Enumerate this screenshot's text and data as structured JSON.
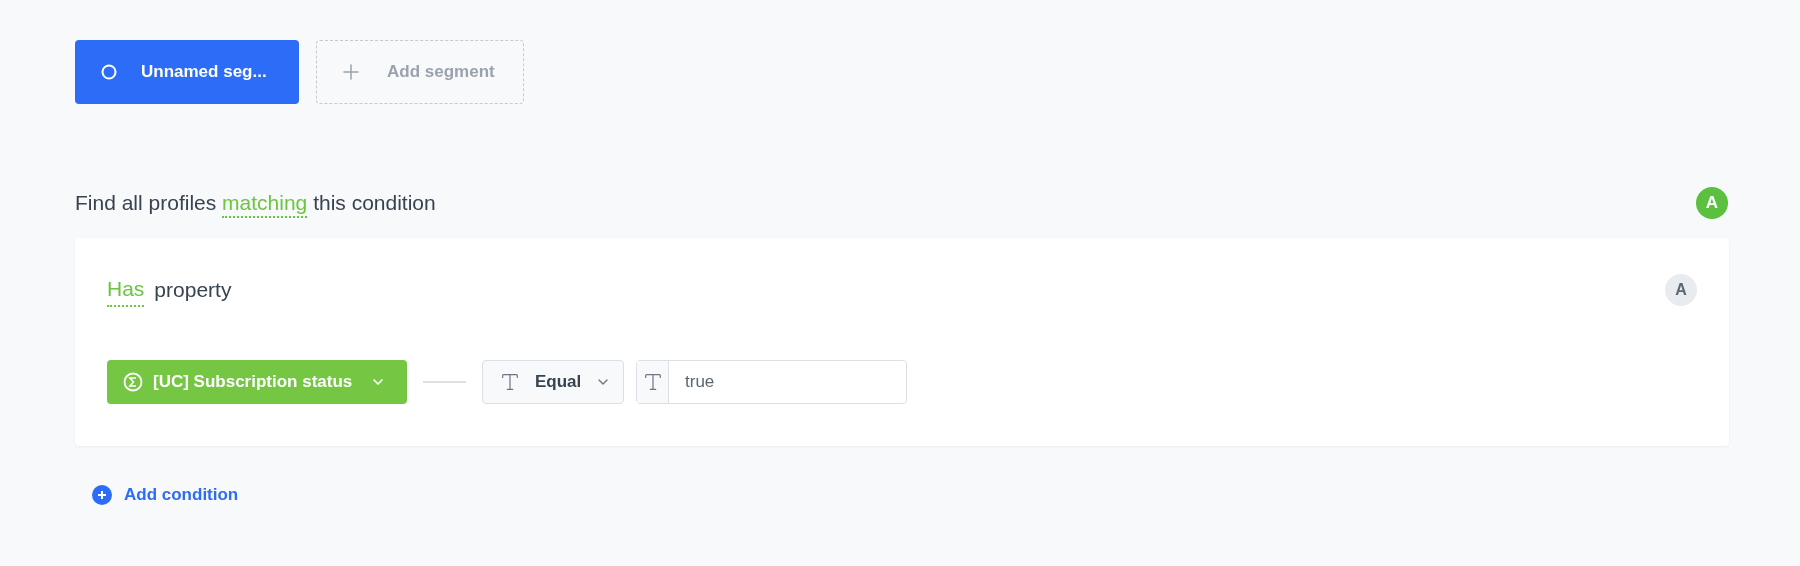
{
  "segments": [
    {
      "label": "Unnamed seg...",
      "selected": true
    }
  ],
  "add_segment": {
    "label": "Add segment"
  },
  "heading": {
    "before": "Find all profiles",
    "operator": "matching",
    "after": "this condition",
    "badge": "A"
  },
  "condition": {
    "operator": "Has",
    "label": "property",
    "badge": "A",
    "property": {
      "label": "[UC] Subscription status"
    },
    "comparison": {
      "label": "Equal"
    },
    "value": "true"
  },
  "add_condition": {
    "label": "Add condition"
  }
}
